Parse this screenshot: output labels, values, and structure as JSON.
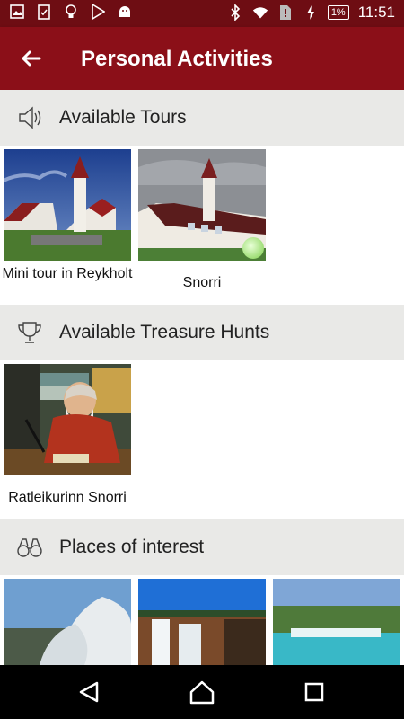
{
  "status_bar": {
    "battery": "1%",
    "time": "11:51",
    "left_icons": [
      "image-icon",
      "clipboard-check-icon",
      "lightbulb-icon",
      "play-store-icon",
      "android-icon"
    ],
    "right_icons": [
      "bluetooth-icon",
      "wifi-icon",
      "no-sim-icon",
      "charging-icon"
    ]
  },
  "app_bar": {
    "title": "Personal Activities"
  },
  "sections": {
    "tours": {
      "label": "Available Tours",
      "items": [
        {
          "caption": "Mini tour in Reykholt"
        },
        {
          "caption": "Snorri"
        }
      ]
    },
    "hunts": {
      "label": "Available Treasure Hunts",
      "items": [
        {
          "caption": "Ratleikurinn Snorri"
        }
      ]
    },
    "places": {
      "label": "Places of interest"
    }
  },
  "colors": {
    "app_bar": "#8b0f18",
    "status_bar": "#6e0d13",
    "section_bg": "#e9e9e7"
  }
}
